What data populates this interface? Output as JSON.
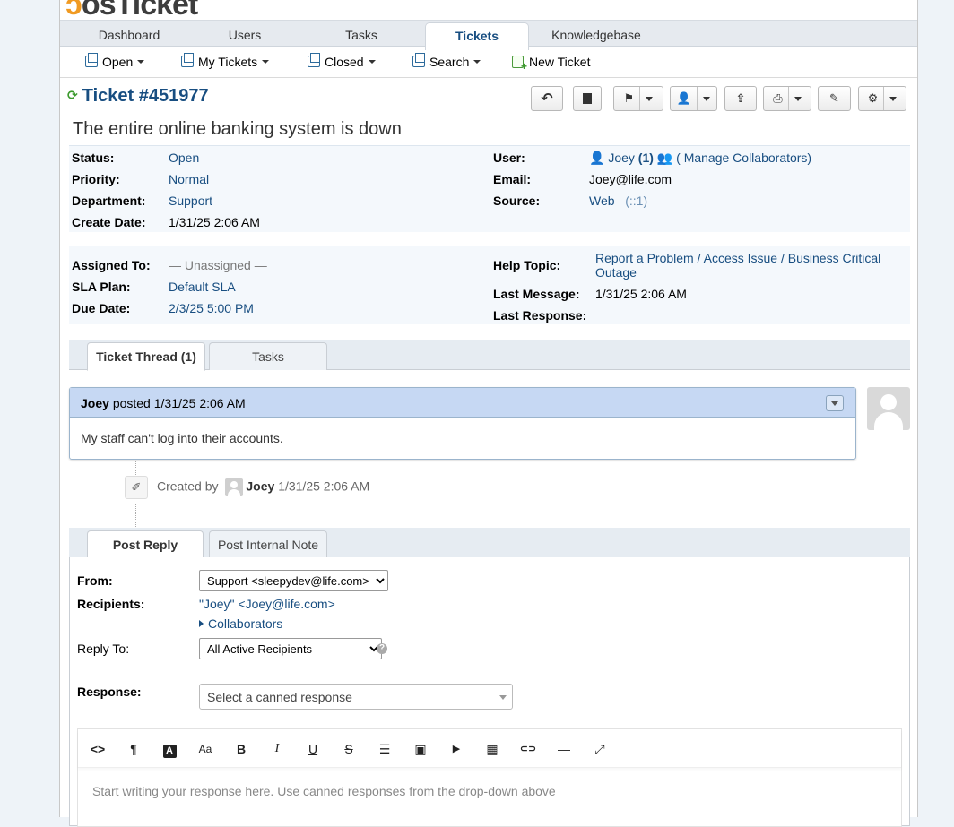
{
  "logo": {
    "part1": "ↄ",
    "part2": "osTicket"
  },
  "nav": {
    "tabs": [
      "Dashboard",
      "Users",
      "Tasks",
      "Tickets",
      "Knowledgebase"
    ],
    "active": "Tickets"
  },
  "subnav": {
    "open": "Open",
    "my_tickets": "My Tickets",
    "closed": "Closed",
    "search": "Search",
    "new_ticket": "New Ticket"
  },
  "ticket": {
    "title": "Ticket #451977",
    "subject": "The entire online banking system is down",
    "status_label": "Status:",
    "status": "Open",
    "priority_label": "Priority:",
    "priority": "Normal",
    "department_label": "Department:",
    "department": "Support",
    "create_date_label": "Create Date:",
    "create_date": "1/31/25 2:06 AM",
    "user_label": "User:",
    "user_name": "Joey",
    "user_count": "(1)",
    "manage_collaborators": "( Manage Collaborators)",
    "email_label": "Email:",
    "email": "Joey@life.com",
    "source_label": "Source:",
    "source": "Web",
    "source_ip": "(::1)",
    "assigned_label": "Assigned To:",
    "assigned": "— Unassigned —",
    "sla_label": "SLA Plan:",
    "sla": "Default SLA",
    "due_label": "Due Date:",
    "due": "2/3/25 5:00 PM",
    "help_topic_label": "Help Topic:",
    "help_topic": "Report a Problem / Access Issue / Business Critical Outage",
    "last_message_label": "Last Message:",
    "last_message": "1/31/25 2:06 AM",
    "last_response_label": "Last Response:",
    "last_response": ""
  },
  "thread_tabs": {
    "thread": "Ticket Thread (1)",
    "tasks": "Tasks"
  },
  "entry": {
    "author": "Joey",
    "posted": "posted 1/31/25 2:06 AM",
    "body": "My staff can't log into their accounts."
  },
  "event": {
    "created_by": "Created by",
    "user": "Joey",
    "time": "1/31/25 2:06 AM"
  },
  "reply_tabs": {
    "post_reply": "Post Reply",
    "internal_note": "Post Internal Note"
  },
  "reply": {
    "from_label": "From:",
    "from_value": "Support <sleepydev@life.com>",
    "recipients_label": "Recipients:",
    "recipients_value": "\"Joey\" <Joey@life.com>",
    "collaborators": "Collaborators",
    "reply_to_label": "Reply To:",
    "reply_to_value": "All Active Recipients",
    "response_label": "Response:",
    "canned_placeholder": "Select a canned response",
    "editor_placeholder": "Start writing your response here. Use canned responses from the drop-down above"
  },
  "editor_toolbar": [
    "<>",
    "¶",
    "A",
    "Aa",
    "B",
    "I",
    "U",
    "S",
    "☰",
    "▣",
    "▶",
    "▦",
    "⊂⊃",
    "—",
    "⤢"
  ],
  "colors": {
    "link": "#184e81",
    "entry_header": "#c6d8f3",
    "info_bg": "#f4f8fc"
  }
}
